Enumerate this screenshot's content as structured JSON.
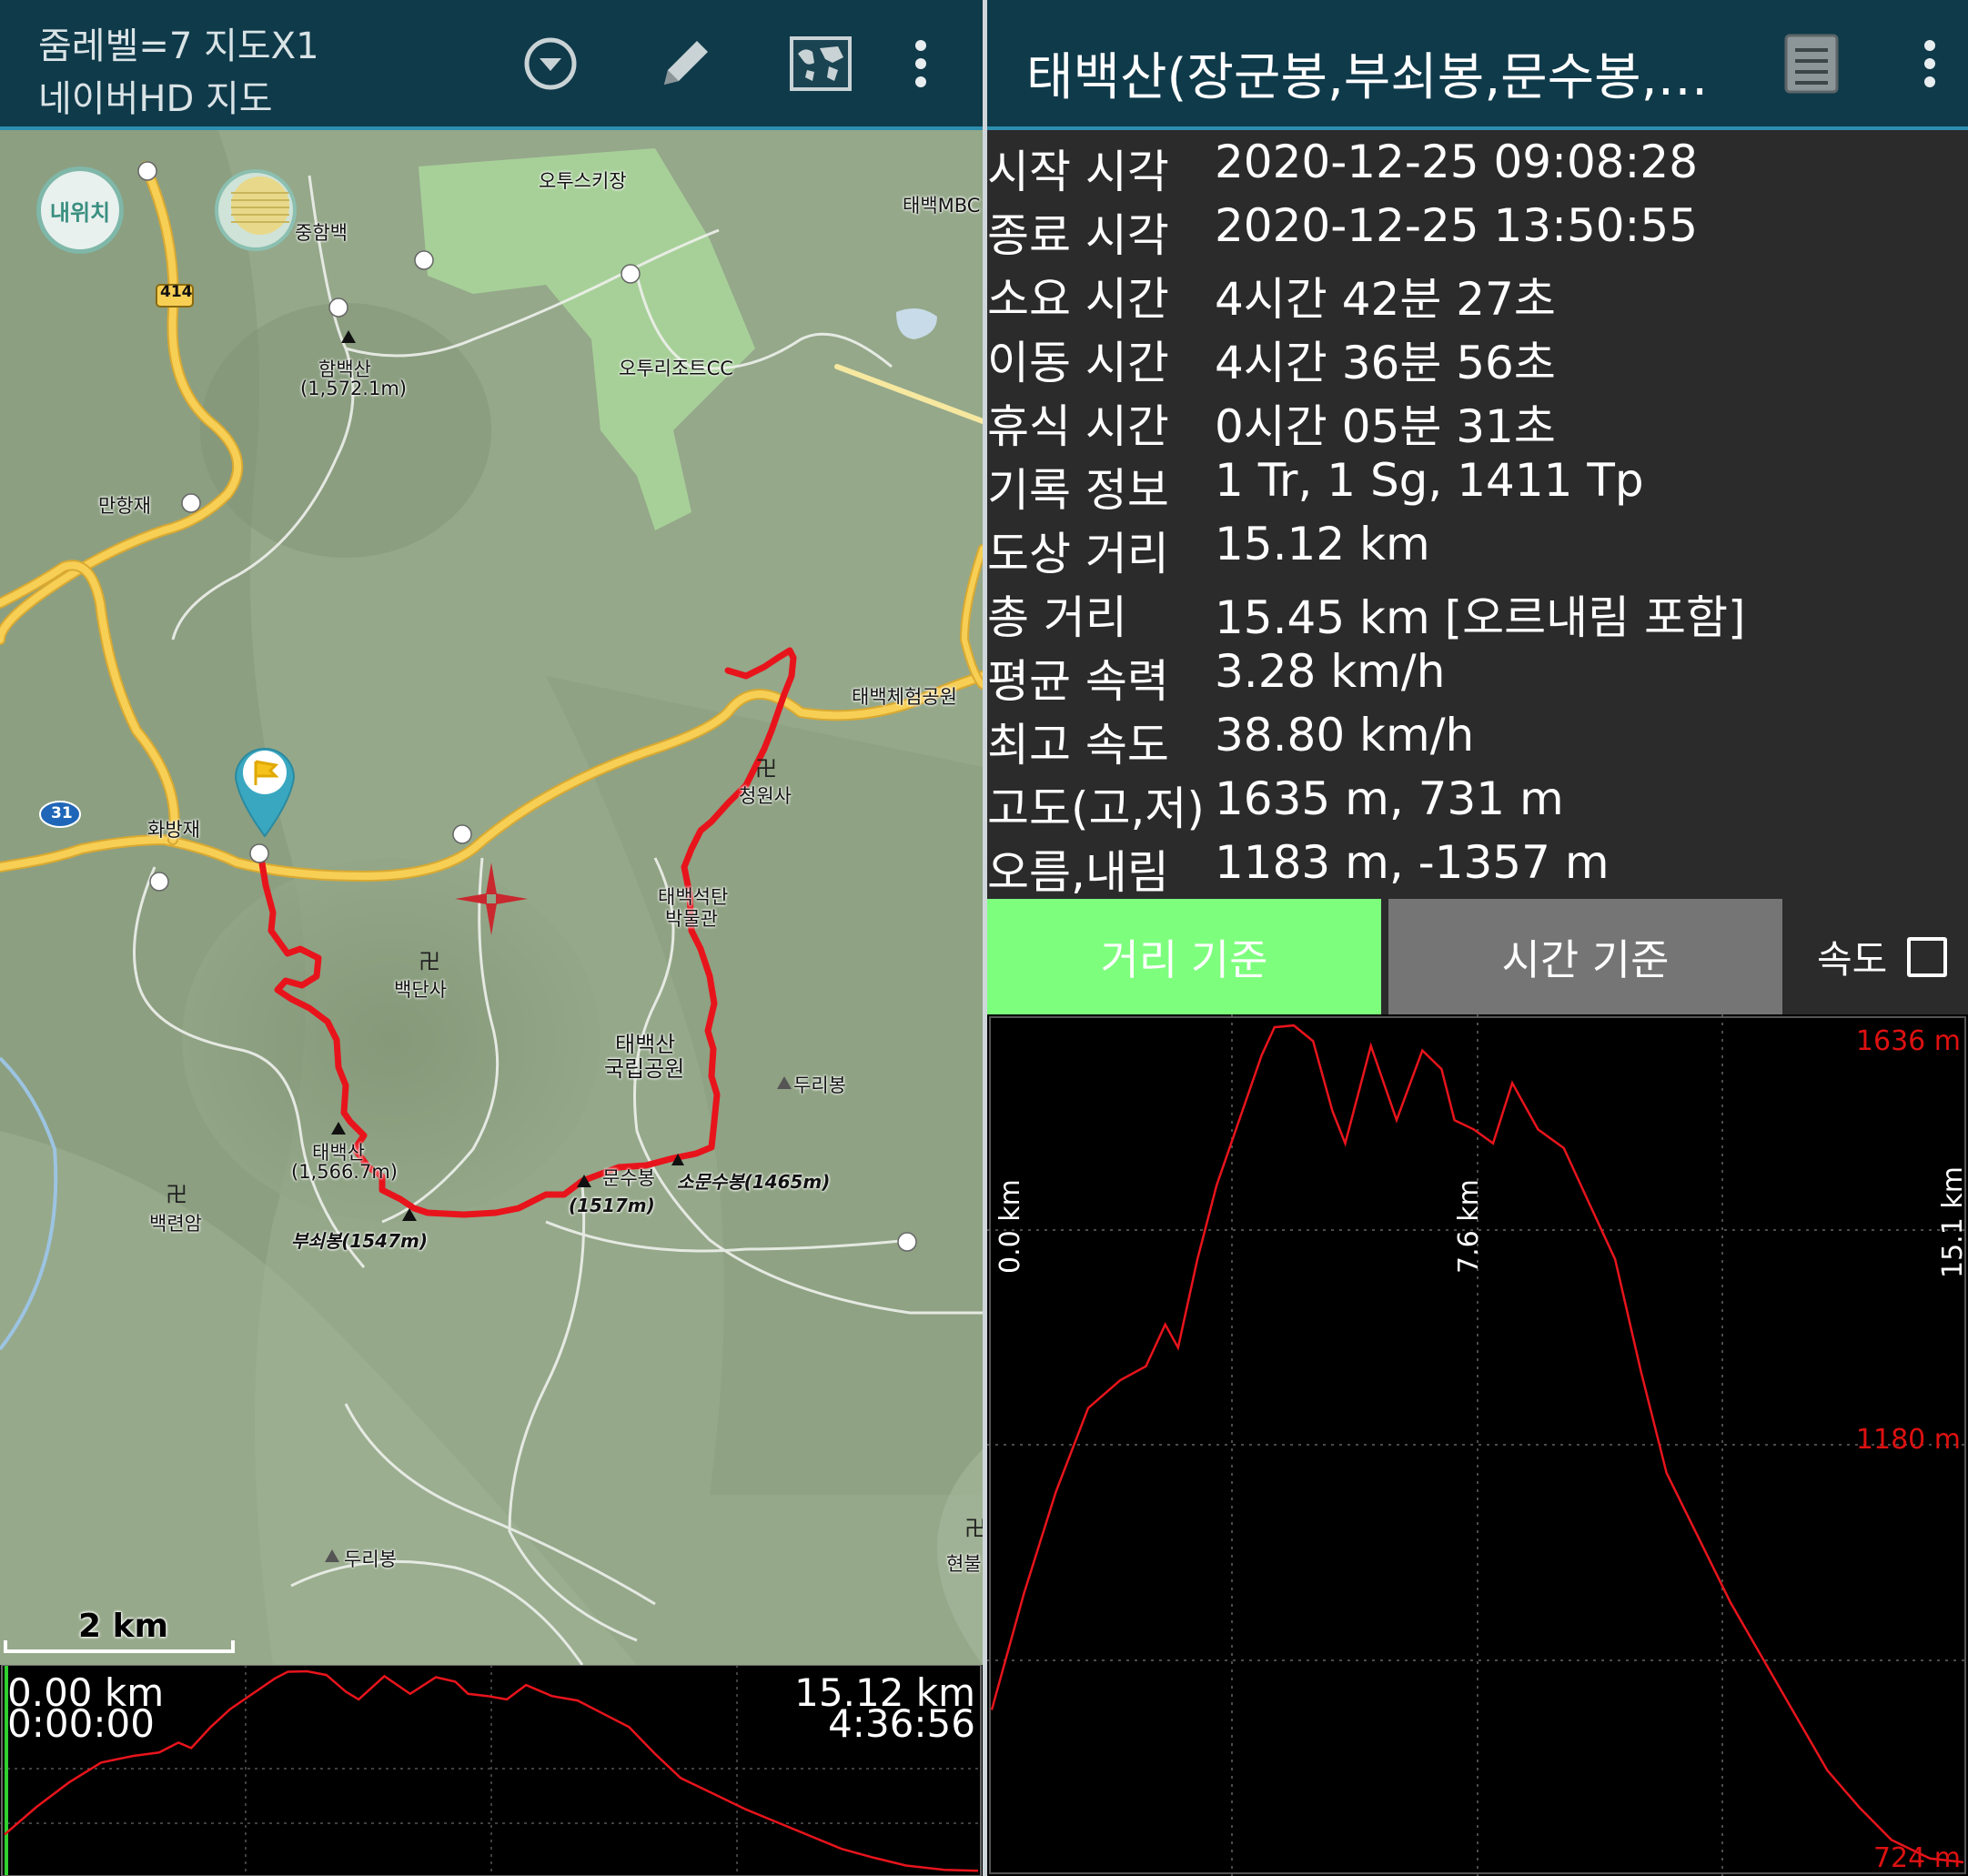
{
  "map_panel": {
    "header": {
      "line1": "줌레벨=7 지도X1",
      "line2": "네이버HD 지도",
      "icons": [
        "dropdown-circle-icon",
        "pencil-icon",
        "world-map-icon",
        "overflow-menu-icon"
      ]
    },
    "my_location_button": "내위치",
    "scale_bar": "2 km",
    "road_badges": [
      "414",
      "31"
    ],
    "place_labels": [
      "오투스키장",
      "태백MBC",
      "중함백",
      "함백산",
      "(1,572.1m)",
      "오투리조트CC",
      "만항재",
      "태백체험공원",
      "청원사",
      "화방재",
      "태백석탄",
      "박물관",
      "백단사",
      "태백산",
      "국립공원",
      "두리봉",
      "태백산",
      "(1,566.7m)",
      "문수봉",
      "소문수봉(1465m)",
      "(1517m)",
      "백련암",
      "부쇠봉(1547m)",
      "두리봉",
      "현불"
    ],
    "mini_profile": {
      "start_distance": "0.00 km",
      "start_time": "0:00:00",
      "end_distance": "15.12 km",
      "end_time": "4:36:56"
    }
  },
  "track_panel": {
    "header": {
      "title": "태백산(장군봉,부쇠봉,문수봉,소문수봉)",
      "icons": [
        "list-document-icon",
        "overflow-menu-icon"
      ]
    },
    "stats": [
      {
        "label": "시작 시각",
        "value": "2020-12-25 09:08:28"
      },
      {
        "label": "종료 시각",
        "value": "2020-12-25 13:50:55"
      },
      {
        "label": "소요 시간",
        "value": "4시간 42분 27초"
      },
      {
        "label": "이동 시간",
        "value": "4시간 36분 56초"
      },
      {
        "label": "휴식 시간",
        "value": "0시간 05분 31초"
      },
      {
        "label": "기록 정보",
        "value": "1 Tr, 1 Sg, 1411 Tp"
      },
      {
        "label": "도상 거리",
        "value": "15.12 km"
      },
      {
        "label": "총 거리",
        "value": "15.45 km [오르내림 포함]"
      },
      {
        "label": "평균 속력",
        "value": "3.28 km/h"
      },
      {
        "label": "최고 속도",
        "value": "38.80 km/h"
      },
      {
        "label": "고도(고,저)",
        "value": "1635 m, 731 m"
      },
      {
        "label": "오름,내림",
        "value": "1183 m, -1357 m"
      }
    ],
    "tabs": {
      "distance": "거리 기준",
      "time": "시간 기준",
      "speed_label": "속도",
      "speed_checked": false,
      "active": "distance"
    },
    "graph_labels": {
      "y_top": "1636 m",
      "y_mid": "1180 m",
      "y_bottom": "724 m",
      "x_start": "0.0 km",
      "x_mid": "7.6 km",
      "x_end": "15.1 km"
    }
  },
  "colors": {
    "header_bg": "#0f3a4a",
    "header_border": "#2d8fb0",
    "track_red": "#e8141c",
    "active_tab": "#7dff7d",
    "inactive_tab": "#757575",
    "axis_label_red": "#dd1111"
  },
  "chart_data": {
    "type": "line",
    "title": "",
    "xlabel": "",
    "ylabel": "",
    "x_unit": "km",
    "y_unit": "m",
    "xlim": [
      0,
      15.12
    ],
    "ylim": [
      724,
      1636
    ],
    "series": [
      {
        "name": "",
        "x": [
          0,
          0.5,
          1.0,
          1.5,
          2.0,
          2.4,
          2.7,
          2.9,
          3.2,
          3.5,
          3.9,
          4.2,
          4.4,
          4.7,
          5.0,
          5.3,
          5.5,
          5.9,
          6.3,
          6.7,
          7.0,
          7.2,
          7.5,
          7.8,
          8.1,
          8.5,
          8.9,
          9.3,
          9.7,
          10.1,
          10.5,
          11.0,
          11.5,
          12.0,
          12.5,
          13.0,
          13.5,
          14.0,
          14.6,
          15.12
        ],
        "y": [
          895,
          1020,
          1130,
          1220,
          1250,
          1265,
          1310,
          1285,
          1380,
          1460,
          1540,
          1600,
          1630,
          1632,
          1615,
          1540,
          1505,
          1610,
          1530,
          1605,
          1585,
          1530,
          1520,
          1505,
          1570,
          1520,
          1500,
          1440,
          1380,
          1260,
          1150,
          1080,
          1010,
          950,
          890,
          830,
          790,
          755,
          735,
          731
        ]
      }
    ]
  }
}
